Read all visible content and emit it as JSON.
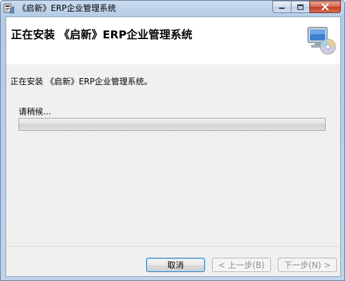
{
  "window": {
    "title": "《启新》ERP企业管理系统"
  },
  "header": {
    "title": "正在安装 《启新》ERP企业管理系统"
  },
  "main": {
    "status_text": "正在安装 《启新》ERP企业管理系统。",
    "wait_text": "请稍候...",
    "progress_fraction": 0
  },
  "buttons": {
    "cancel_label": "取消",
    "back_label": "< 上一步(B)",
    "next_label": "下一步(N) >"
  },
  "colors": {
    "progress_fill": "#2ea52e",
    "close_button": "#c43c22"
  },
  "icons": {
    "app": "installer-app-icon",
    "header": "computer-disc-icon"
  }
}
